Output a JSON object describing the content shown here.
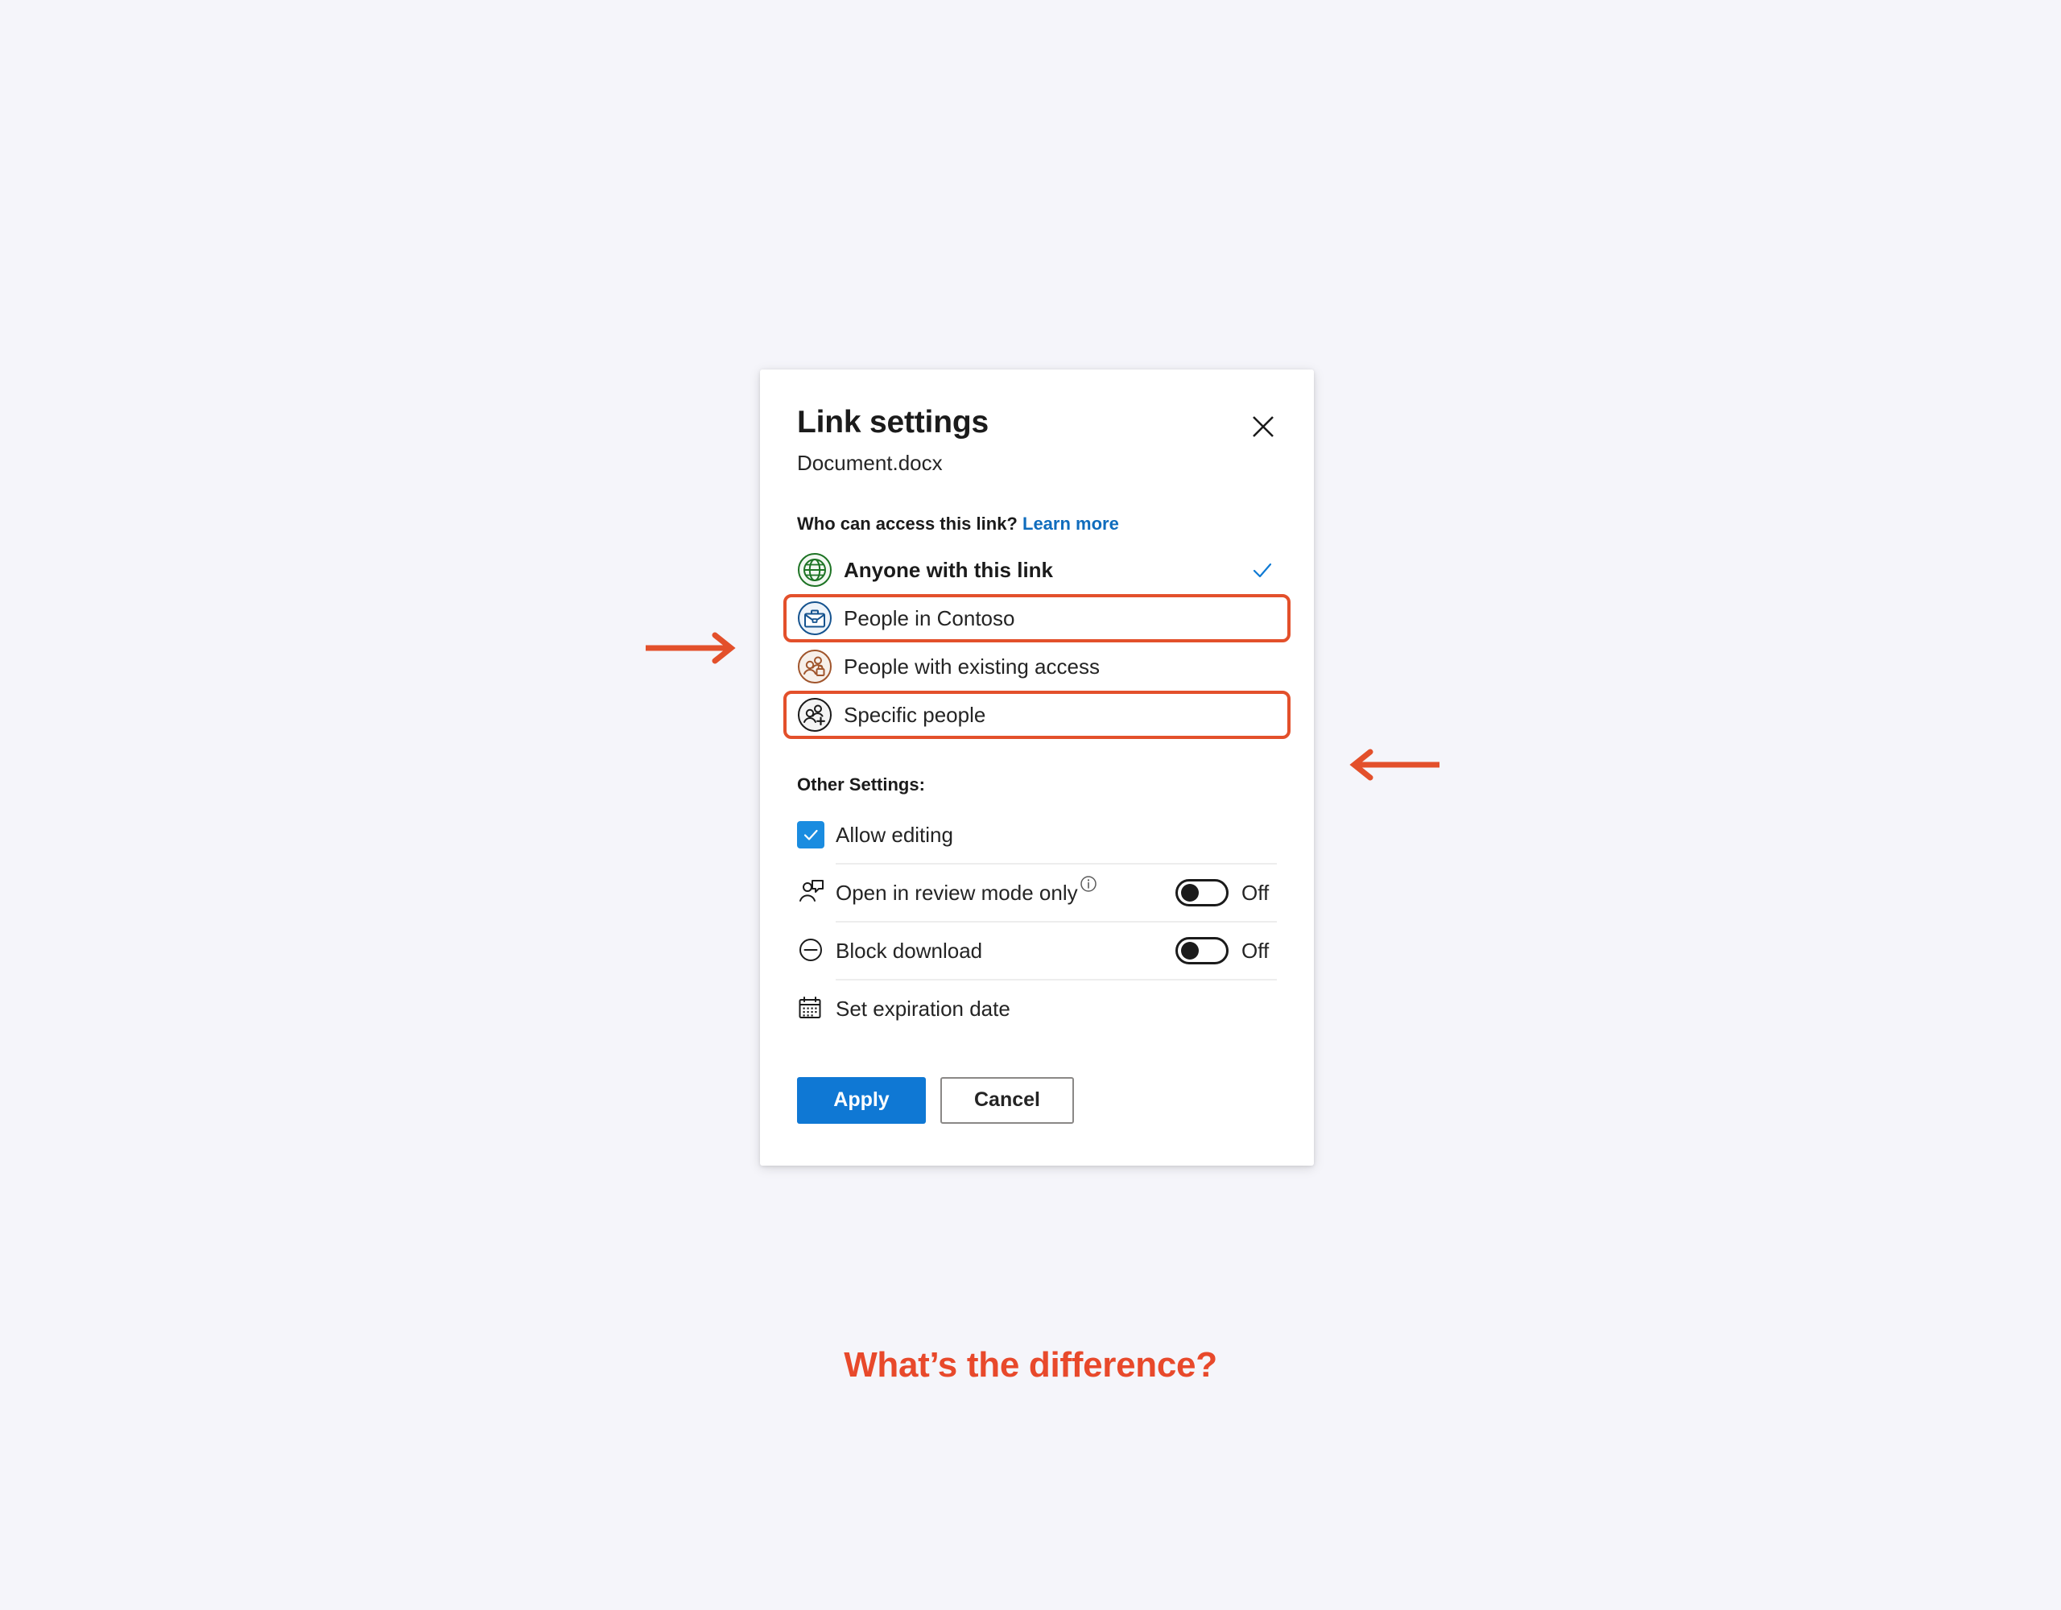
{
  "page": {
    "background_color": "#f5f5fa",
    "caption": "What’s the difference?",
    "caption_color": "#e8492b",
    "accent_color": "#e3502b"
  },
  "dialog": {
    "title": "Link settings",
    "subtitle": "Document.docx",
    "close_icon": "close-icon",
    "access": {
      "question": "Who can access this link?",
      "learn_more": "Learn more",
      "learn_more_color": "#0f6cbd",
      "options": [
        {
          "label": "Anyone with this link",
          "icon": "globe-icon",
          "icon_color": "#1d7324",
          "selected": true,
          "highlighted": false,
          "check_icon": "checkmark-icon"
        },
        {
          "label": "People in Contoso",
          "icon": "briefcase-icon",
          "icon_color": "#15538f",
          "selected": false,
          "highlighted": true
        },
        {
          "label": "People with existing access",
          "icon": "people-lock-icon",
          "icon_color": "#a0552c",
          "selected": false,
          "highlighted": false
        },
        {
          "label": "Specific people",
          "icon": "people-add-icon",
          "icon_color": "#1b1b1b",
          "selected": false,
          "highlighted": true
        }
      ]
    },
    "other_settings": {
      "heading": "Other Settings:",
      "rows": [
        {
          "label": "Allow editing",
          "control": "checkbox",
          "checked": true,
          "checkbox_color": "#1a8ce0",
          "lead_icon": "checkbox-checked-icon"
        },
        {
          "label": "Open in review mode only",
          "control": "toggle",
          "state": "Off",
          "lead_icon": "person-comment-icon",
          "info_icon": "info-circle-icon"
        },
        {
          "label": "Block download",
          "control": "toggle",
          "state": "Off",
          "lead_icon": "block-circle-icon"
        },
        {
          "label": "Set expiration date",
          "control": "none",
          "lead_icon": "calendar-icon"
        }
      ]
    },
    "buttons": {
      "apply": "Apply",
      "apply_color": "#0f78d4",
      "cancel": "Cancel"
    }
  },
  "annotations": [
    {
      "name": "arrow-to-people-in-contoso",
      "direction": "right",
      "color": "#e3502b"
    },
    {
      "name": "arrow-to-specific-people",
      "direction": "left",
      "color": "#e3502b"
    }
  ]
}
